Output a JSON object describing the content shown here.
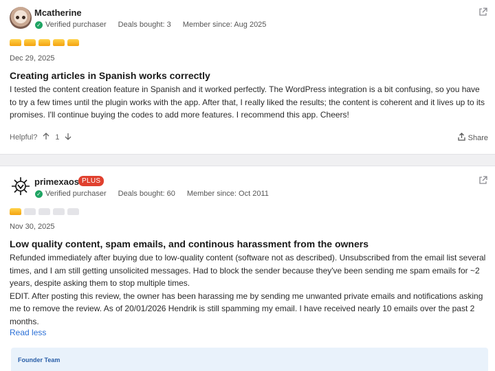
{
  "reviews": [
    {
      "username": "Mcatherine",
      "verified": "Verified purchaser",
      "deals": "Deals bought: 3",
      "member_since": "Member since: Aug 2025",
      "rating": 5,
      "date": "Dec 29, 2025",
      "title": "Creating articles in Spanish works correctly",
      "body": "I tested the content creation feature in Spanish and it worked perfectly. The WordPress integration is a bit confusing, so you have to try a few times until the plugin works with the app. After that, I really liked the results; the content is coherent and it lives up to its promises. I'll continue buying the codes to add more features. I recommend this app. Cheers!",
      "helpful_label": "Helpful?",
      "helpful_count": "1",
      "share_label": "Share"
    },
    {
      "username": "primexaos",
      "badge": "PLUS",
      "verified": "Verified purchaser",
      "deals": "Deals bought: 60",
      "member_since": "Member since: Oct 2011",
      "rating": 1,
      "date": "Nov 30, 2025",
      "title": "Low quality content, spam emails, and continous harassment from the owners",
      "body_p1": "Refunded immediately after buying due to low-quality content (software not as described). Unsubscribed from the email list several times, and I am still getting unsolicited messages. Had to block the sender because they've been sending me spam emails for ~2 years, despite asking them to stop multiple times.",
      "body_p2": "EDIT. After posting this review, the owner has been harassing me by sending me unwanted private emails and notifications asking me to remove the review. As of 20/01/2026 Hendrik is still spamming my email. I have received nearly 10 emails over the past 2 months.",
      "read_less": "Read less",
      "founder_label": "Founder Team"
    }
  ],
  "colors": {
    "verified": "#1fa463",
    "plus_badge": "#e0402e",
    "link": "#2a6fd6",
    "star": "#f4a30f"
  },
  "icons": [
    "external-link-icon",
    "verified-check-icon",
    "thumbs-up-arrow-icon",
    "thumbs-down-arrow-icon",
    "share-icon"
  ]
}
